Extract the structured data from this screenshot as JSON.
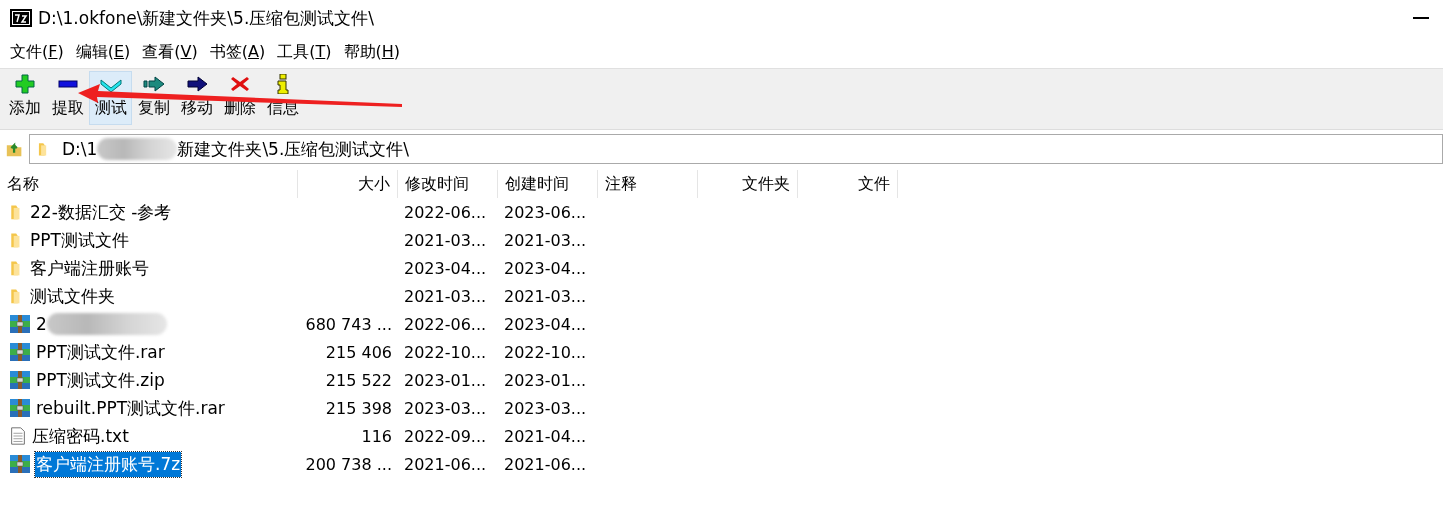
{
  "window": {
    "title": "D:\\1.okfone\\新建文件夹\\5.压缩包测试文件\\"
  },
  "menu": [
    {
      "before": "文件(",
      "key": "F",
      "after": ")"
    },
    {
      "before": "编辑(",
      "key": "E",
      "after": ")"
    },
    {
      "before": "查看(",
      "key": "V",
      "after": ")"
    },
    {
      "before": "书签(",
      "key": "A",
      "after": ")"
    },
    {
      "before": "工具(",
      "key": "T",
      "after": ")"
    },
    {
      "before": "帮助(",
      "key": "H",
      "after": ")"
    }
  ],
  "toolbar": [
    {
      "kind": "add",
      "label": "添加",
      "hovered": false
    },
    {
      "kind": "extract",
      "label": "提取",
      "hovered": false
    },
    {
      "kind": "test",
      "label": "测试",
      "hovered": true
    },
    {
      "kind": "copy",
      "label": "复制",
      "hovered": false
    },
    {
      "kind": "move",
      "label": "移动",
      "hovered": false
    },
    {
      "kind": "delete",
      "label": "删除",
      "hovered": false
    },
    {
      "kind": "info",
      "label": "信息",
      "hovered": false
    }
  ],
  "address": {
    "before": "D:\\1",
    "after": "新建文件夹\\5.压缩包测试文件\\",
    "redacted": true
  },
  "columns": [
    "名称",
    "大小",
    "修改时间",
    "创建时间",
    "注释",
    "文件夹",
    "文件"
  ],
  "rows": [
    {
      "kind": "folder",
      "name": "22-数据汇交 -参考",
      "size": "",
      "modified": "2022-06...",
      "created": "2023-06...",
      "selected": false
    },
    {
      "kind": "folder",
      "name": "PPT测试文件",
      "size": "",
      "modified": "2021-03...",
      "created": "2021-03...",
      "selected": false
    },
    {
      "kind": "folder",
      "name": "客户端注册账号",
      "size": "",
      "modified": "2023-04...",
      "created": "2023-04...",
      "selected": false
    },
    {
      "kind": "folder",
      "name": "测试文件夹",
      "size": "",
      "modified": "2021-03...",
      "created": "2021-03...",
      "selected": false
    },
    {
      "kind": "archive",
      "name": "2",
      "redacted": true,
      "size": "680 743 ...",
      "modified": "2022-06...",
      "created": "2023-04...",
      "selected": false
    },
    {
      "kind": "archive",
      "name": "PPT测试文件.rar",
      "size": "215 406",
      "modified": "2022-10...",
      "created": "2022-10...",
      "selected": false
    },
    {
      "kind": "archive",
      "name": "PPT测试文件.zip",
      "size": "215 522",
      "modified": "2023-01...",
      "created": "2023-01...",
      "selected": false
    },
    {
      "kind": "archive",
      "name": "rebuilt.PPT测试文件.rar",
      "size": "215 398",
      "modified": "2023-03...",
      "created": "2023-03...",
      "selected": false
    },
    {
      "kind": "text",
      "name": "压缩密码.txt",
      "size": "116",
      "modified": "2022-09...",
      "created": "2021-04...",
      "selected": false
    },
    {
      "kind": "archive",
      "name": "客户端注册账号.7z",
      "size": "200 738 ...",
      "modified": "2021-06...",
      "created": "2021-06...",
      "selected": true
    }
  ]
}
